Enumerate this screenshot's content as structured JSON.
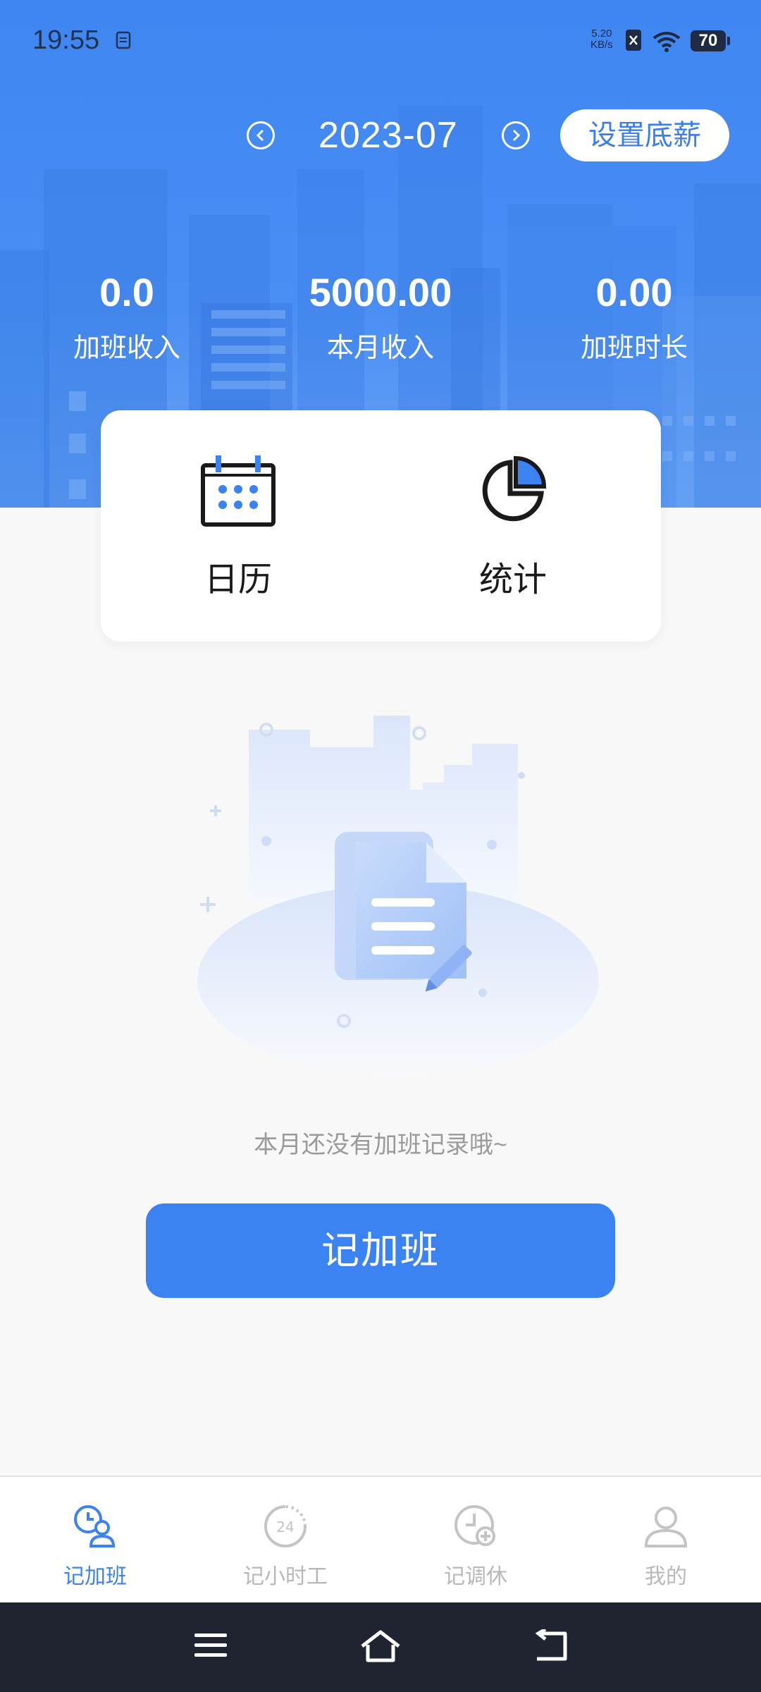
{
  "status_bar": {
    "time": "19:55",
    "net_speed_value": "5.20",
    "net_speed_unit": "KB/s",
    "battery": "70"
  },
  "header": {
    "month": "2023-07",
    "set_salary_label": "设置底薪"
  },
  "stats": [
    {
      "value": "0.0",
      "label": "加班收入"
    },
    {
      "value": "5000.00",
      "label": "本月收入"
    },
    {
      "value": "0.00",
      "label": "加班时长"
    }
  ],
  "quick_actions": [
    {
      "label": "日历",
      "icon": "calendar-icon"
    },
    {
      "label": "统计",
      "icon": "pie-chart-icon"
    }
  ],
  "empty_state": {
    "message": "本月还没有加班记录哦~",
    "button_label": "记加班"
  },
  "tabs": [
    {
      "label": "记加班",
      "icon": "clock-person-icon",
      "active": true
    },
    {
      "label": "记小时工",
      "icon": "24h-clock-icon",
      "active": false
    },
    {
      "label": "记调休",
      "icon": "clock-plus-icon",
      "active": false
    },
    {
      "label": "我的",
      "icon": "user-icon",
      "active": false
    }
  ],
  "colors": {
    "primary": "#3b82f2",
    "hero_bg": "#4a8ef4",
    "inactive_tab": "#b8b8b8",
    "navbar_bg": "#1f2430"
  }
}
